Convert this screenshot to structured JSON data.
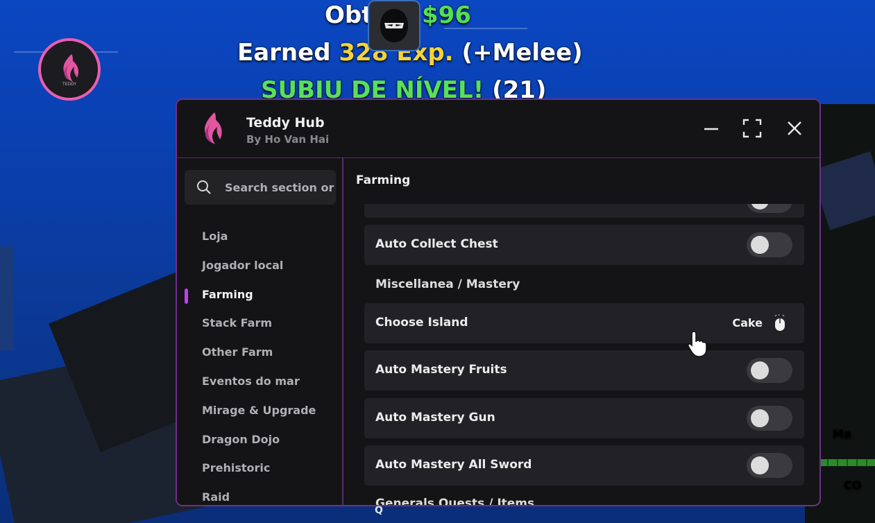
{
  "hud": {
    "obtained_label": "Obt",
    "money": "$96",
    "earned_prefix": "Earned",
    "earned_exp": "328 Exp.",
    "earned_suffix": "(+Melee)",
    "level_up_text": "SUBIU DE NÍVEL!",
    "level_value": "(21)",
    "right_text_1": "Ma",
    "right_text_2": "CO"
  },
  "window": {
    "title": "Teddy Hub",
    "subtitle": "By Ho Van Hai"
  },
  "search": {
    "placeholder": "Search section or"
  },
  "sidebar": {
    "items": [
      {
        "label": "Loja",
        "active": false
      },
      {
        "label": "Jogador local",
        "active": false
      },
      {
        "label": "Farming",
        "active": true
      },
      {
        "label": "Stack Farm",
        "active": false
      },
      {
        "label": "Other Farm",
        "active": false
      },
      {
        "label": "Eventos do mar",
        "active": false
      },
      {
        "label": "Mirage & Upgrade",
        "active": false
      },
      {
        "label": "Dragon Dojo",
        "active": false
      },
      {
        "label": "Prehistoric",
        "active": false
      },
      {
        "label": "Raid",
        "active": false
      }
    ]
  },
  "main": {
    "section_title": "Farming",
    "rows": [
      {
        "type": "toggle",
        "label": "",
        "state": "off"
      },
      {
        "type": "toggle",
        "label": "Auto Collect Chest",
        "state": "off"
      },
      {
        "type": "category",
        "label": "Miscellanea / Mastery"
      },
      {
        "type": "dropdown",
        "label": "Choose Island",
        "value": "Cake"
      },
      {
        "type": "toggle",
        "label": "Auto Mastery Fruits",
        "state": "off"
      },
      {
        "type": "toggle",
        "label": "Auto Mastery Gun",
        "state": "off"
      },
      {
        "type": "toggle",
        "label": "Auto Mastery All Sword",
        "state": "off"
      },
      {
        "type": "category",
        "label": "Generals Quests / Items"
      }
    ]
  },
  "colors": {
    "accent": "#c040f0",
    "window_bg": "#141416",
    "card_bg": "#222226",
    "money_green": "#54e054",
    "exp_yellow": "#f3d23c",
    "logo_pink": "#ea5fae"
  },
  "icons": {
    "search": "search-icon",
    "minimize": "minimize-icon",
    "maximize": "maximize-icon",
    "close": "close-icon",
    "dropdown": "mouse-icon",
    "cursor": "hand-cursor-icon"
  }
}
